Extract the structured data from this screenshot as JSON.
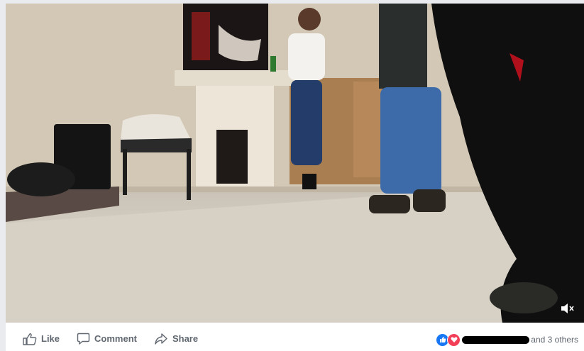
{
  "video": {
    "description_label": "",
    "mute_icon": "speaker-muted-icon"
  },
  "actions": {
    "like_label": "Like",
    "comment_label": "Comment",
    "share_label": "Share"
  },
  "reactions": {
    "icons": [
      "like-reaction-icon",
      "love-reaction-icon"
    ],
    "others_text": "and 3 others"
  },
  "colors": {
    "action_text": "#606770",
    "like_blue": "#1877f2",
    "love_red": "#f33e58"
  }
}
